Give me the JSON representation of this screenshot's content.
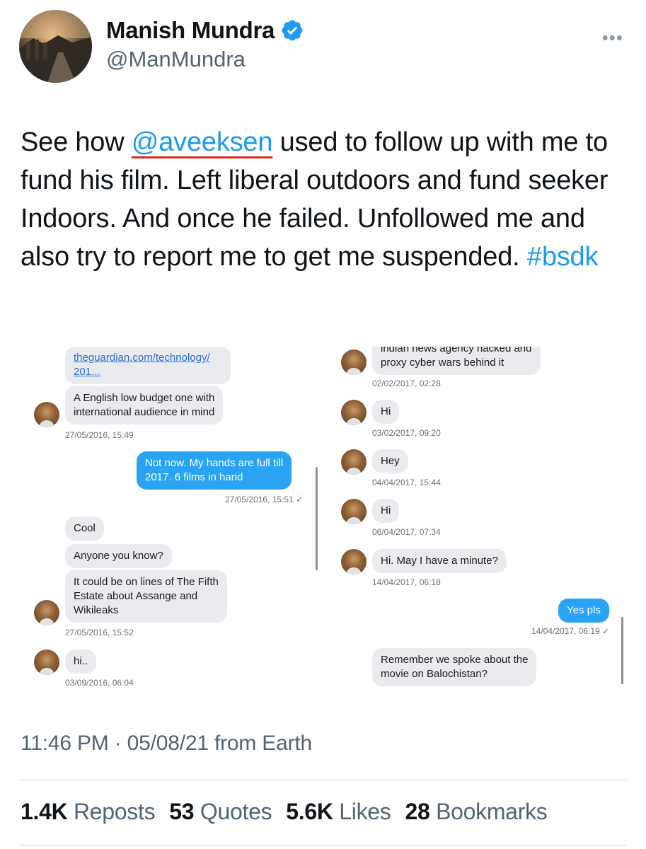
{
  "author": {
    "name": "Manish Mundra",
    "handle": "@ManMundra"
  },
  "tweet": {
    "prefix": "See how ",
    "mention": "@aveeksen",
    "body": " used to follow up with me to fund his film. Left liberal outdoors and fund seeker Indoors. And once he failed. Unfollowed me and also try to report me to get me suspended. ",
    "hashtag": "#bsdk"
  },
  "left_chat": {
    "link_line1": "theguardian.com/technology/",
    "link_line2": "201...",
    "msg1_line1": "A English low budget one with",
    "msg1_line2": "international audience in mind",
    "ts1": "27/05/2016, 15:49",
    "reply_line1": "Not now. My hands are full till",
    "reply_line2": "2017. 6 films in hand",
    "ts2": "27/05/2016, 15:51 ✓",
    "msg2": "Cool",
    "msg3": "Anyone you know?",
    "msg4_line1": "It could be on lines of The Fifth",
    "msg4_line2": "Estate about Assange and",
    "msg4_line3": "Wikileaks",
    "ts3": "27/05/2016, 15:52",
    "msg5": "hi..",
    "ts4": "03/09/2016, 06:04"
  },
  "right_chat": {
    "msg0_line1": "indian news agency hacked and",
    "msg0_line2": "proxy cyber wars behind it",
    "ts0": "02/02/2017, 02:28",
    "msg1": "Hi",
    "ts1": "03/02/2017, 09:20",
    "msg2": "Hey",
    "ts2": "04/04/2017, 15:44",
    "msg3": "Hi",
    "ts3": "06/04/2017, 07:34",
    "msg4": "Hi. May I have a minute?",
    "ts4": "14/04/2017, 06:18",
    "reply": "Yes pls",
    "ts5": "14/04/2017, 06:19 ✓",
    "msg5_line1": "Remember we spoke about the",
    "msg5_line2": "movie on Balochistan?"
  },
  "footer": {
    "timestamp": "11:46 PM · 05/08/21 from Earth",
    "reposts_count": "1.4K",
    "reposts_label": "Reposts",
    "quotes_count": "53",
    "quotes_label": "Quotes",
    "likes_count": "5.6K",
    "likes_label": "Likes",
    "bookmarks_count": "28",
    "bookmarks_label": "Bookmarks"
  },
  "colors": {
    "link": "#1d9bf0",
    "underline_accent": "#d42b1e",
    "chat_blue": "#2aa3f2",
    "chat_grey": "#e9ebee",
    "muted": "#536471"
  }
}
